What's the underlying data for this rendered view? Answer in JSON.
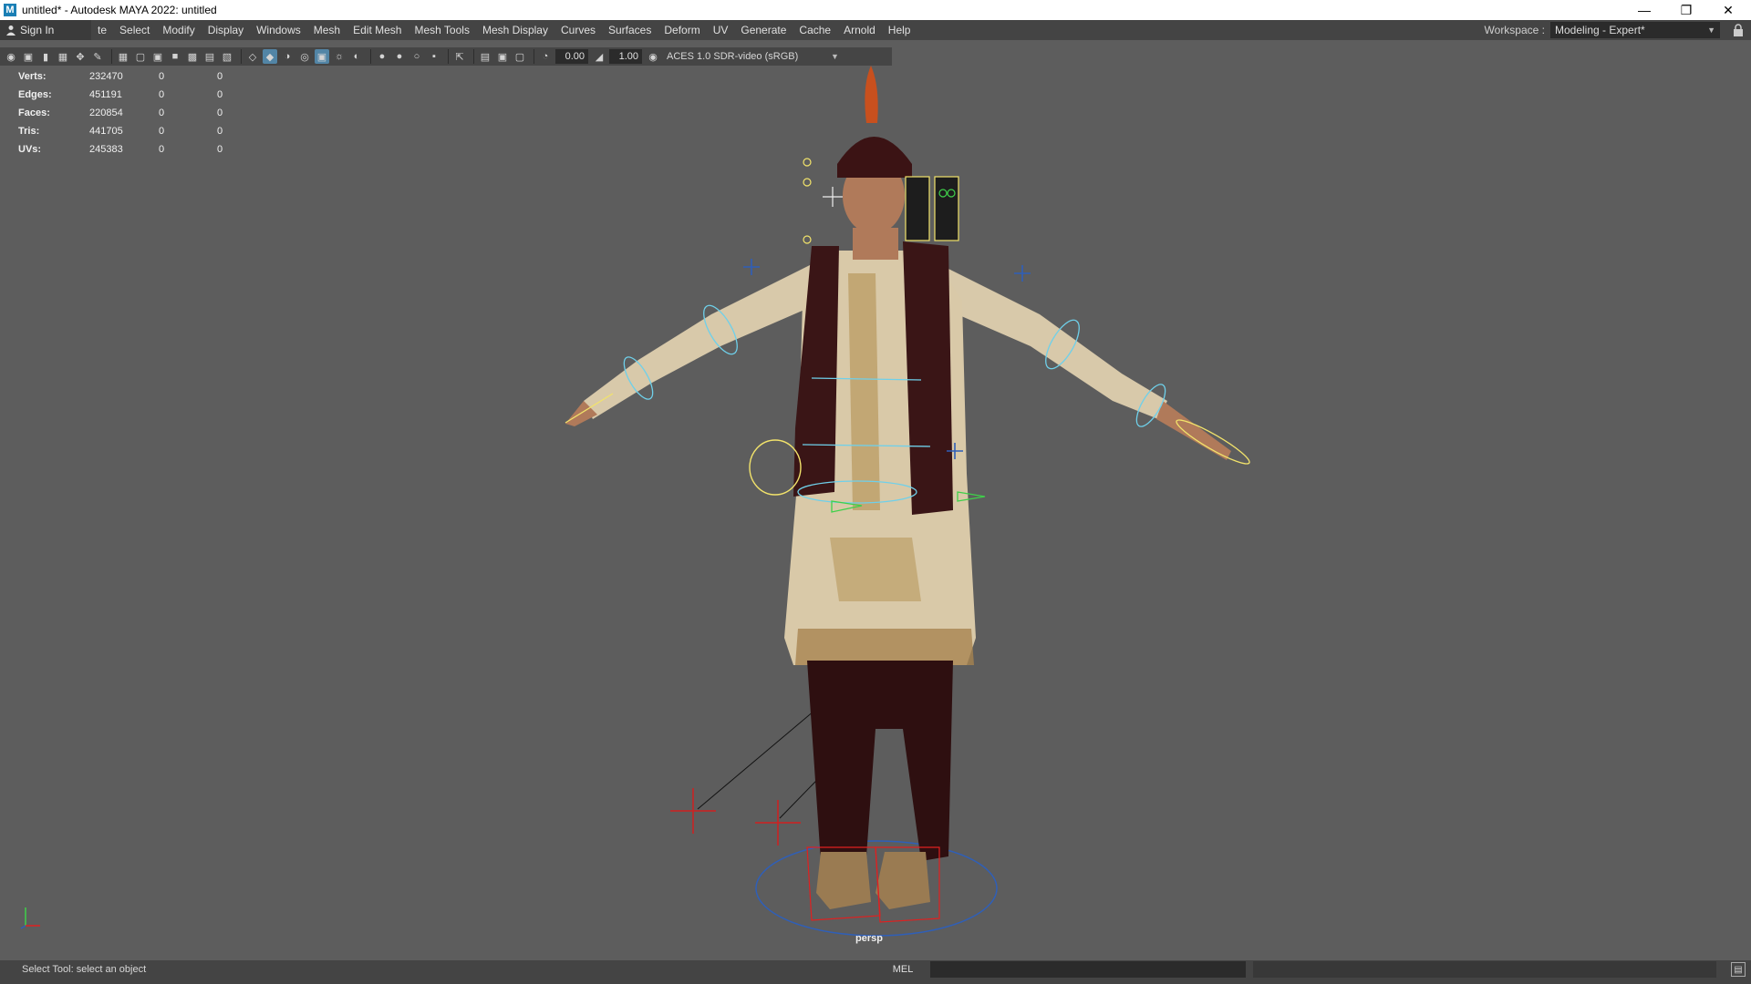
{
  "window": {
    "title": "untitled* - Autodesk MAYA 2022: untitled",
    "app_icon": "M",
    "controls": [
      "minimize-icon",
      "restore-icon",
      "close-icon"
    ]
  },
  "menubar": {
    "sign_in": "Sign In",
    "items": [
      "te",
      "Select",
      "Modify",
      "Display",
      "Windows",
      "Mesh",
      "Edit Mesh",
      "Mesh Tools",
      "Mesh Display",
      "Curves",
      "Surfaces",
      "Deform",
      "UV",
      "Generate",
      "Cache",
      "Arnold",
      "Help"
    ],
    "workspace_label": "Workspace :",
    "workspace_value": "Modeling - Expert*"
  },
  "toolbar": {
    "exposure": "0.00",
    "gamma": "1.00",
    "colorspace": "ACES 1.0 SDR-video (sRGB)"
  },
  "hud": {
    "rows": [
      {
        "label": "Verts:",
        "v1": "232470",
        "v2": "0",
        "v3": "0"
      },
      {
        "label": "Edges:",
        "v1": "451191",
        "v2": "0",
        "v3": "0"
      },
      {
        "label": "Faces:",
        "v1": "220854",
        "v2": "0",
        "v3": "0"
      },
      {
        "label": "Tris:",
        "v1": "441705",
        "v2": "0",
        "v3": "0"
      },
      {
        "label": "UVs:",
        "v1": "245383",
        "v2": "0",
        "v3": "0"
      }
    ]
  },
  "viewport": {
    "camera": "persp",
    "colors": {
      "background": "#5d5d5d",
      "robe": "#d9c9a8",
      "scarf": "#3a1516",
      "pants": "#2e0f10",
      "rig_yellow": "#f2e36b",
      "rig_cyan": "#6fd0ea",
      "rig_red": "#e02020",
      "rig_blue": "#2f5fb8"
    }
  },
  "statusline": {
    "message": "Select Tool: select an object",
    "mel_label": "MEL"
  }
}
